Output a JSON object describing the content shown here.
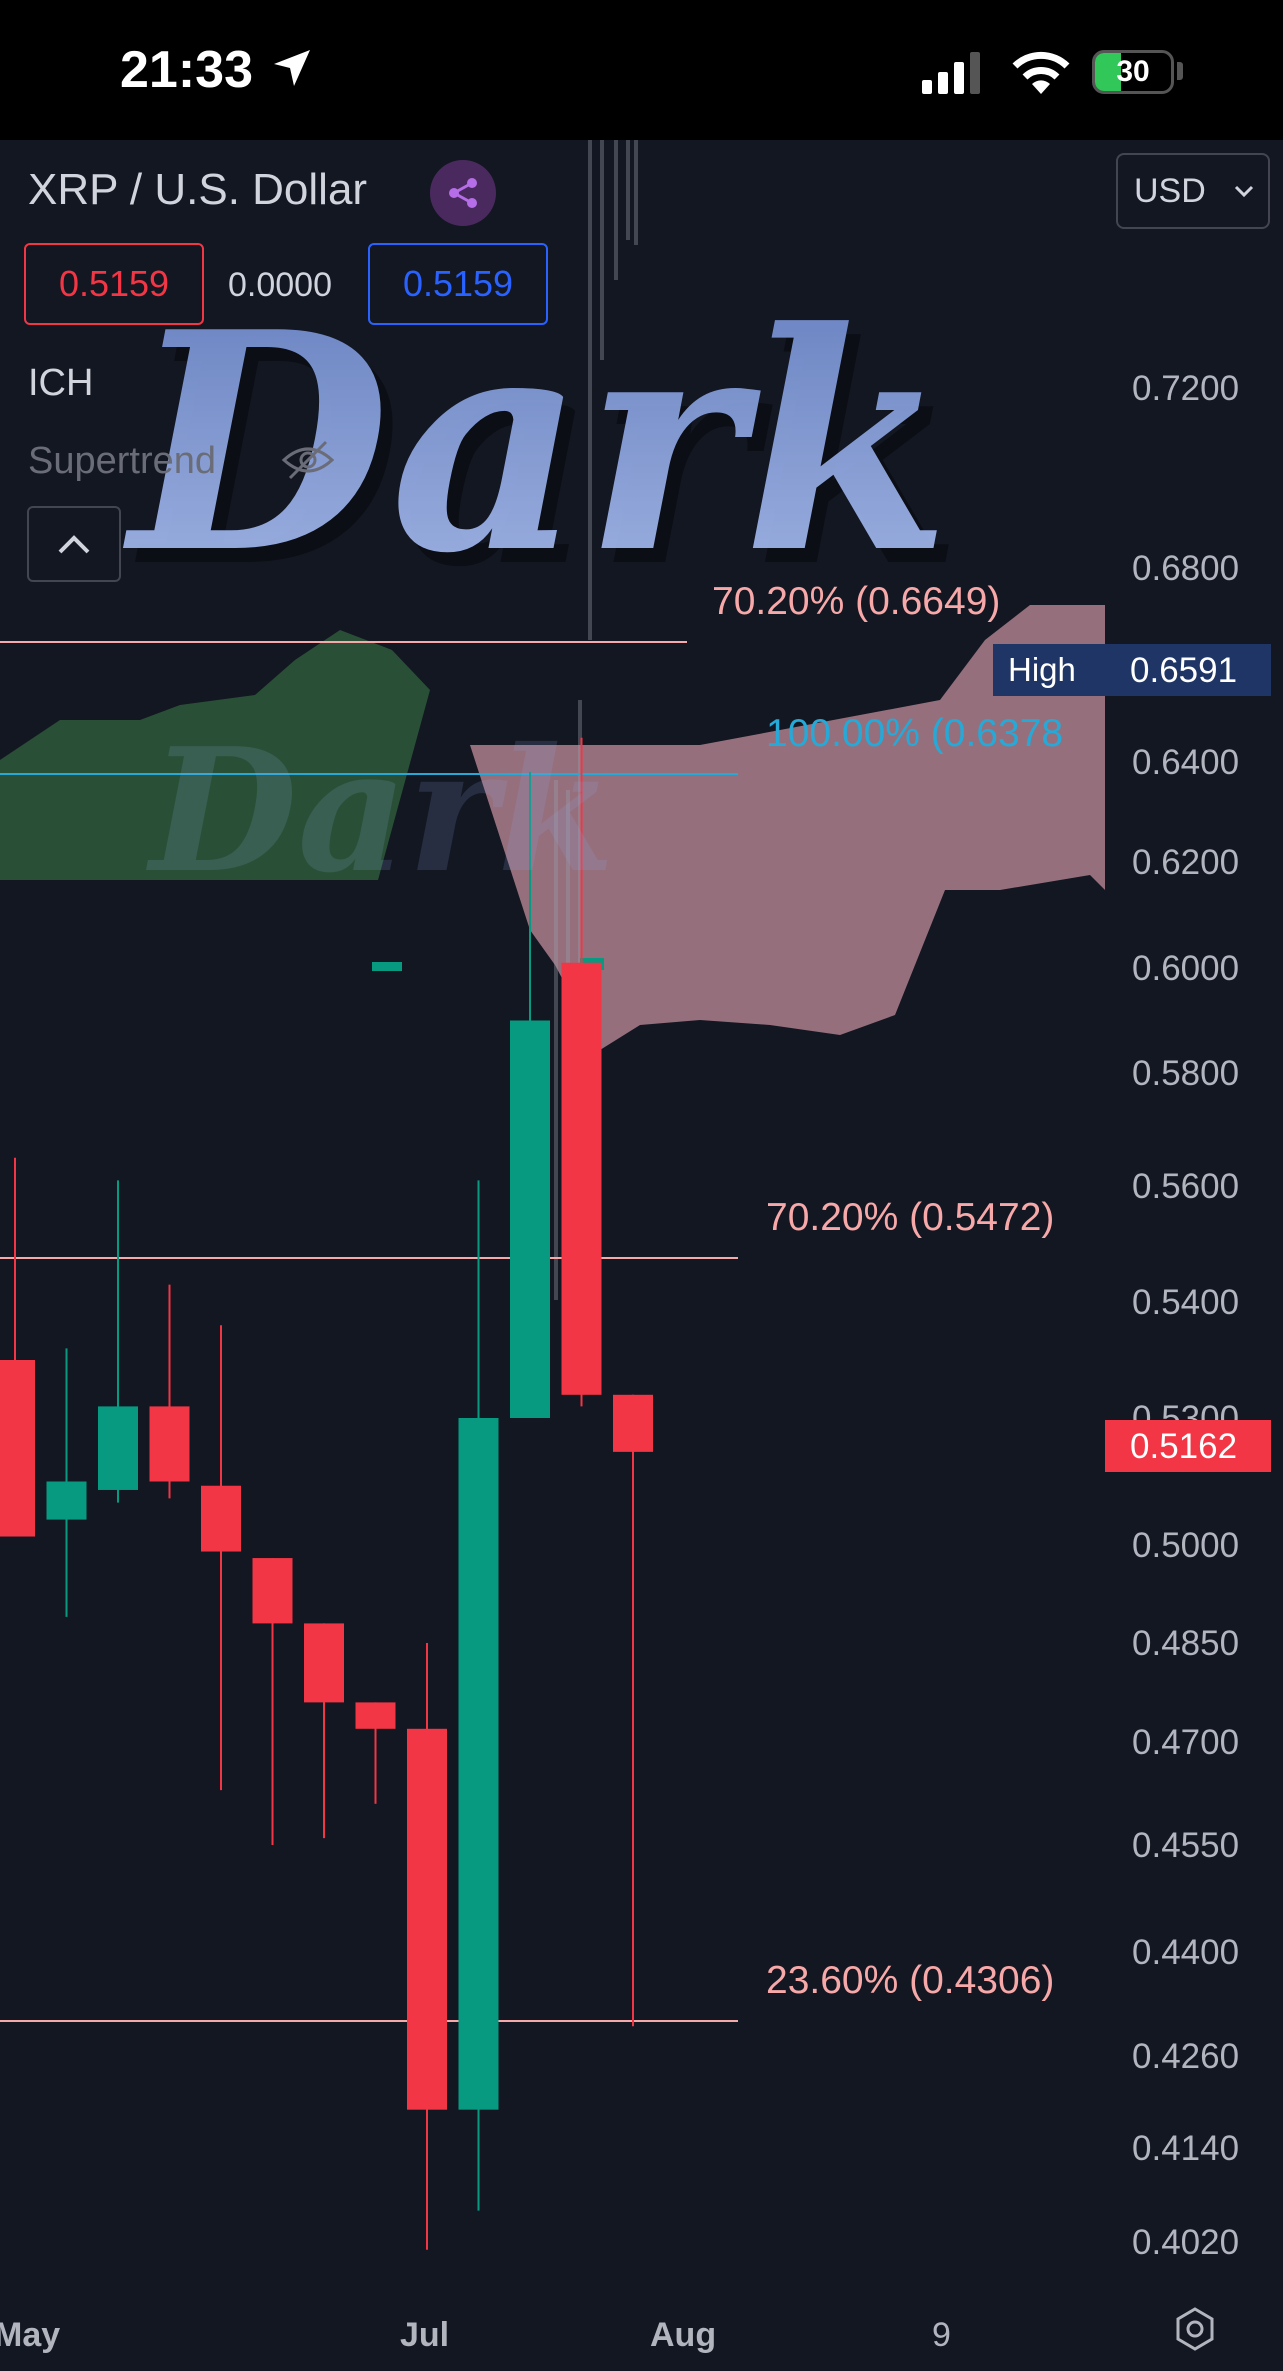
{
  "status_bar": {
    "time": "21:33",
    "battery": "30"
  },
  "header": {
    "symbol": "XRP / U.S. Dollar",
    "bid": "0.5159",
    "spread": "0.0000",
    "ask": "0.5159",
    "currency": "USD"
  },
  "indicators": [
    {
      "label": "ICH"
    },
    {
      "label": "Supertrend"
    }
  ],
  "watermark": "Dark",
  "price_axis": {
    "ticks": [
      "0.7200",
      "0.6800",
      "0.6400",
      "0.6200",
      "0.6000",
      "0.5800",
      "0.5600",
      "0.5400",
      "0.5000",
      "0.4850",
      "0.4700",
      "0.4550",
      "0.4400",
      "0.4260",
      "0.4140",
      "0.4020"
    ],
    "partial_tick": "0.5300"
  },
  "time_axis": {
    "labels": [
      "May",
      "Jul",
      "Aug",
      "9"
    ]
  },
  "fib_levels": [
    {
      "label": "70.20% (0.6649)",
      "color": "#f7a8a8"
    },
    {
      "label": "100.00% (0.6378",
      "color": "#26a9d6"
    },
    {
      "label": "70.20% (0.5472)",
      "color": "#f7a8a8"
    },
    {
      "label": "23.60% (0.4306)",
      "color": "#f7a8a8"
    }
  ],
  "high_marker": {
    "label": "High",
    "value": "0.6591"
  },
  "last_price": "0.5162",
  "colors": {
    "background": "#131722",
    "up": "#089981",
    "down": "#f23645",
    "cloud_bull": "#2e5a3a",
    "cloud_bear": "#e6a7b5",
    "watermark": "#8fa8e6"
  },
  "chart_data": {
    "type": "candlestick",
    "timeframe": "weekly",
    "candles": [
      {
        "o": 0.535,
        "h": 0.565,
        "l": 0.503,
        "c": 0.502
      },
      {
        "o": 0.506,
        "h": 0.536,
        "l": 0.489,
        "c": 0.515
      },
      {
        "o": 0.513,
        "h": 0.561,
        "l": 0.51,
        "c": 0.531
      },
      {
        "o": 0.531,
        "h": 0.543,
        "l": 0.511,
        "c": 0.515
      },
      {
        "o": 0.514,
        "h": 0.538,
        "l": 0.463,
        "c": 0.499
      },
      {
        "o": 0.498,
        "h": 0.488,
        "l": 0.455,
        "c": 0.488
      },
      {
        "o": 0.488,
        "h": 0.485,
        "l": 0.456,
        "c": 0.476
      },
      {
        "o": 0.476,
        "h": 0.475,
        "l": 0.461,
        "c": 0.472
      },
      {
        "o": 0.472,
        "h": 0.485,
        "l": 0.401,
        "c": 0.419
      },
      {
        "o": 0.419,
        "h": 0.561,
        "l": 0.406,
        "c": 0.53
      },
      {
        "o": 0.53,
        "h": 0.638,
        "l": 0.53,
        "c": 0.59
      },
      {
        "o": 0.601,
        "h": 0.645,
        "l": 0.531,
        "c": 0.532
      },
      {
        "o": 0.532,
        "h": 0.531,
        "l": 0.43,
        "c": 0.522
      }
    ]
  }
}
